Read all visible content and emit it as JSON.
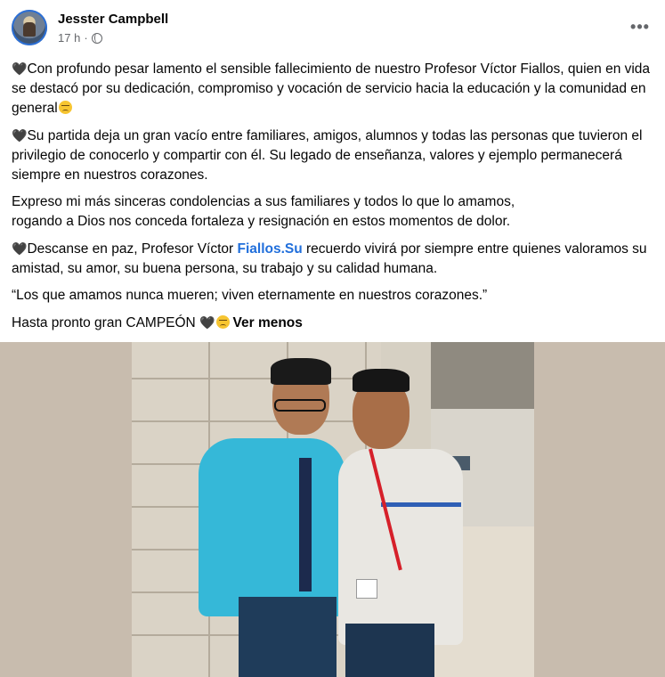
{
  "post": {
    "author": "Jesster Campbell",
    "time": "17 h",
    "separator": "·",
    "more_label": "•••",
    "icons": {
      "privacy": "globe-icon",
      "more": "more-options-icon",
      "heart": "black-heart-emoji",
      "sad": "disappointed-face-emoji"
    },
    "paragraph1": {
      "heart": "🖤",
      "text": "Con profundo pesar lamento el sensible fallecimiento de nuestro Profesor Víctor Fiallos, quien en vida se destacó por su dedicación, compromiso y vocación de servicio hacia la educación y la comunidad en general"
    },
    "paragraph2": {
      "heart": "🖤",
      "text": "Su partida deja un gran vacío entre familiares, amigos, alumnos y todas las personas que tuvieron el privilegio de conocerlo y compartir con él. Su legado de enseñanza, valores y ejemplo permanecerá siempre en nuestros corazones."
    },
    "paragraph3": {
      "line1": "Expreso mi más sinceras condolencias a sus familiares y todos lo que lo amamos,",
      "line2": " rogando a Dios nos conceda fortaleza y resignación en estos momentos de dolor."
    },
    "paragraph4": {
      "heart": "🖤",
      "before": "Descanse en paz, Profesor Víctor ",
      "link": "Fiallos.Su",
      "after": " recuerdo vivirá por siempre entre quienes valoramos su amistad, su amor, su buena persona, su trabajo y su calidad humana."
    },
    "paragraph5": "“Los que amamos nunca mueren; viven eternamente en nuestros corazones.”",
    "paragraph6": {
      "text": "Hasta pronto gran CAMPEÓN ",
      "heart": "🖤",
      "see_less": "Ver menos"
    }
  },
  "colors": {
    "link": "#216fdb",
    "secondary_text": "#65676b",
    "primary_text": "#050505",
    "photo_backdrop": "#c8bcae"
  }
}
